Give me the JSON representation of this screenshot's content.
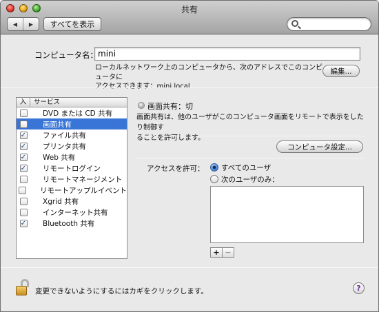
{
  "window": {
    "title": "共有"
  },
  "toolbar": {
    "back": "◀",
    "forward": "▶",
    "show_all": "すべてを表示",
    "search_placeholder": ""
  },
  "computer": {
    "label": "コンピュータ名：",
    "name": "mini",
    "desc_line1": "ローカルネットワーク上のコンピュータから、次のアドレスでこのコンピュータに",
    "desc_line2": "アクセスできます：mini.local",
    "edit_button": "編集..."
  },
  "services": {
    "col_on": "入",
    "col_service": "サービス",
    "items": [
      {
        "name": "DVD または CD 共有",
        "checked": false,
        "selected": false
      },
      {
        "name": "画面共有",
        "checked": false,
        "selected": true
      },
      {
        "name": "ファイル共有",
        "checked": true,
        "selected": false
      },
      {
        "name": "プリンタ共有",
        "checked": true,
        "selected": false
      },
      {
        "name": "Web 共有",
        "checked": true,
        "selected": false
      },
      {
        "name": "リモートログイン",
        "checked": true,
        "selected": false
      },
      {
        "name": "リモートマネージメント",
        "checked": false,
        "selected": false
      },
      {
        "name": "リモートアップルイベント",
        "checked": false,
        "selected": false
      },
      {
        "name": "Xgrid 共有",
        "checked": false,
        "selected": false
      },
      {
        "name": "インターネット共有",
        "checked": false,
        "selected": false
      },
      {
        "name": "Bluetooth 共有",
        "checked": true,
        "selected": false
      }
    ]
  },
  "detail": {
    "status": "画面共有：切",
    "info_line1": "画面共有は、他のユーザがこのコンピュータ画面をリモートで表示をしたり制御す",
    "info_line2": "ることを許可します。",
    "computer_settings": "コンピュータ設定...",
    "access_label": "アクセスを許可：",
    "radio_all": "すべてのユーザ",
    "radio_only": "次のユーザのみ：",
    "plus": "+",
    "minus": "−"
  },
  "footer": {
    "lock_text": "変更できないようにするにはカギをクリックします。",
    "help": "?"
  },
  "colors": {
    "selection": "#3875d7",
    "help_glyph": "#6b2ea3"
  }
}
